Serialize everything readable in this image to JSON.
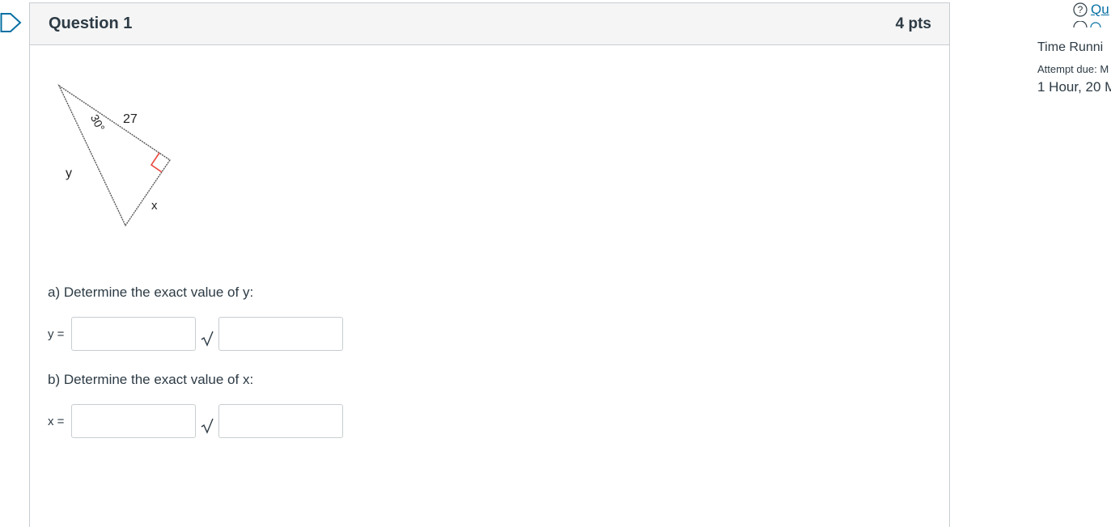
{
  "question": {
    "title": "Question 1",
    "points": "4 pts"
  },
  "figure": {
    "side_hypotenuse_label": "27",
    "angle_label": "30°",
    "side_y_label": "y",
    "side_x_label": "x"
  },
  "part_a": {
    "prompt": "a) Determine the exact value of y:",
    "label": "y =",
    "coefficient_value": "",
    "radicand_value": ""
  },
  "part_b": {
    "prompt": "b) Determine the exact value of x:",
    "label": "x =",
    "coefficient_value": "",
    "radicand_value": ""
  },
  "sidebar": {
    "link_label": "Qu",
    "time_title": "Time Runni",
    "attempt_due": "Attempt due: M",
    "time_value": "1 Hour, 20 M"
  },
  "colors": {
    "link": "#0770a3",
    "flag": "#0770a3",
    "right_angle_marker": "#e8473e"
  }
}
